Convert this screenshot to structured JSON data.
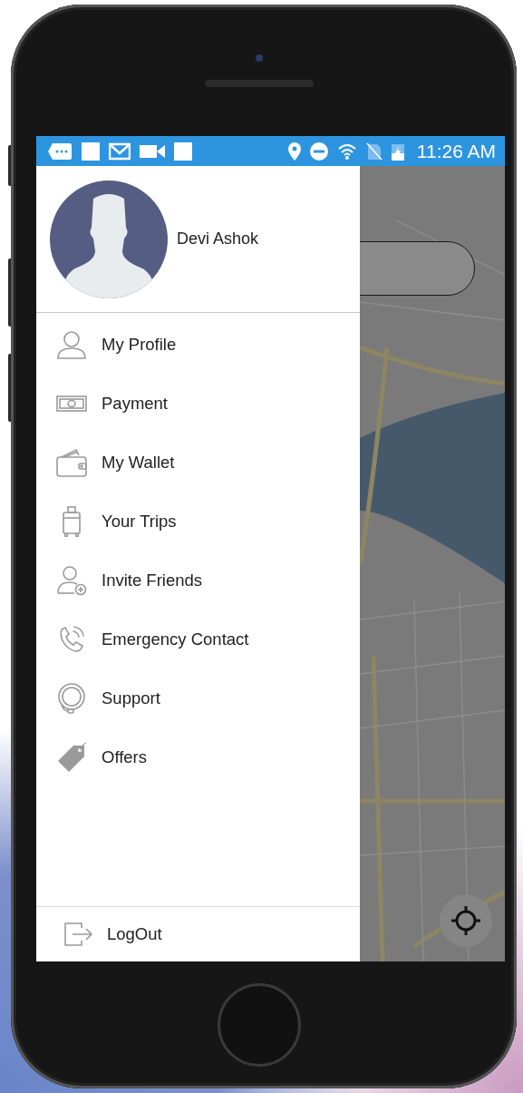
{
  "status_bar": {
    "time": "11:26 AM"
  },
  "drawer": {
    "user_name": "Devi Ashok",
    "items": [
      {
        "label": "My Profile",
        "kind": "profile"
      },
      {
        "label": "Payment",
        "kind": "payment"
      },
      {
        "label": "My Wallet",
        "kind": "wallet"
      },
      {
        "label": "Your Trips",
        "kind": "trips"
      },
      {
        "label": "Invite Friends",
        "kind": "invite"
      },
      {
        "label": "Emergency Contact",
        "kind": "emergency"
      },
      {
        "label": "Support",
        "kind": "support"
      },
      {
        "label": "Offers",
        "kind": "offers"
      }
    ],
    "logout": {
      "label": "LogOut"
    }
  }
}
